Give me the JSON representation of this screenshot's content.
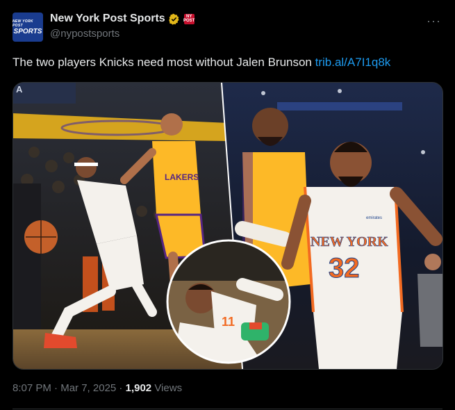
{
  "account": {
    "display_name": "New York Post Sports",
    "handle": "@nypostsports",
    "avatar_text_top": "NEW YORK POST",
    "avatar_text_main": "SPORTS",
    "affiliate_badge_text": "NY POST",
    "verified_icon": "verified-gold-check-icon"
  },
  "post": {
    "text": "The two players Knicks need most without Jalen Brunson ",
    "link": "trib.al/A7I1q8k"
  },
  "media": {
    "jersey_left_team": "LAKERS",
    "jersey_right_team": "NEW YORK",
    "jersey_right_number": "32",
    "jersey_inset_number": "11",
    "banner_letter": "A",
    "sponsor_patch": "emirates"
  },
  "meta": {
    "time": "8:07 PM",
    "separator": " · ",
    "date": "Mar 7, 2025",
    "views_count": "1,902",
    "views_label": " Views"
  },
  "colors": {
    "accent_link": "#1d9bf0",
    "muted": "#71767b",
    "knicks_orange": "#f26a21",
    "lakers_gold": "#fdb927",
    "lakers_purple": "#552583"
  }
}
